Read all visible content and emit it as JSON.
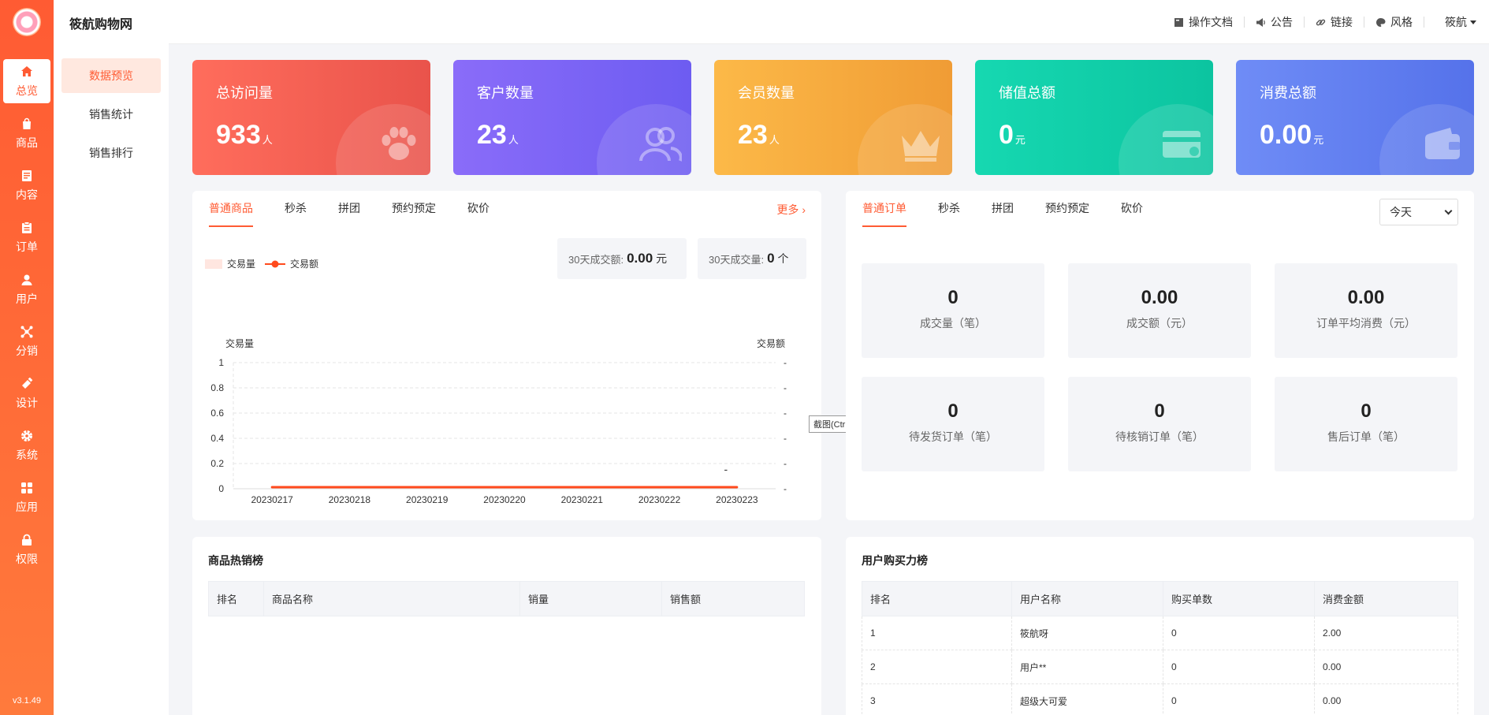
{
  "app": {
    "title": "筱航购物网",
    "version": "v3.1.49"
  },
  "sidebar": {
    "items": [
      {
        "label": "总览",
        "icon": "home-icon",
        "active": true
      },
      {
        "label": "商品",
        "icon": "shopping-bag-icon"
      },
      {
        "label": "内容",
        "icon": "document-icon"
      },
      {
        "label": "订单",
        "icon": "clipboard-icon"
      },
      {
        "label": "用户",
        "icon": "user-icon"
      },
      {
        "label": "分销",
        "icon": "share-network-icon"
      },
      {
        "label": "设计",
        "icon": "brush-icon"
      },
      {
        "label": "系统",
        "icon": "gear-icon"
      },
      {
        "label": "应用",
        "icon": "grid-apps-icon"
      },
      {
        "label": "权限",
        "icon": "lock-icon"
      }
    ]
  },
  "subnav": {
    "items": [
      {
        "label": "数据预览",
        "active": true
      },
      {
        "label": "销售统计"
      },
      {
        "label": "销售排行"
      }
    ]
  },
  "header": {
    "links": [
      {
        "label": "操作文档",
        "icon": "book-icon"
      },
      {
        "label": "公告",
        "icon": "megaphone-icon"
      },
      {
        "label": "链接",
        "icon": "link-icon"
      },
      {
        "label": "风格",
        "icon": "palette-icon"
      }
    ],
    "user": "筱航"
  },
  "stats": [
    {
      "label": "总访问量",
      "value": "933",
      "unit": "人",
      "icon": "paw-icon"
    },
    {
      "label": "客户数量",
      "value": "23",
      "unit": "人",
      "icon": "users-icon"
    },
    {
      "label": "会员数量",
      "value": "23",
      "unit": "人",
      "icon": "crown-icon"
    },
    {
      "label": "储值总额",
      "value": "0",
      "unit": "元",
      "icon": "card-icon"
    },
    {
      "label": "消费总额",
      "value": "0.00",
      "unit": "元",
      "icon": "wallet-icon"
    }
  ],
  "goods_panel": {
    "tabs": [
      "普通商品",
      "秒杀",
      "拼团",
      "预约预定",
      "砍价"
    ],
    "more": "更多",
    "legend": [
      "交易量",
      "交易额"
    ],
    "summary_amount_label": "30天成交额:",
    "summary_amount_value": "0.00",
    "summary_amount_unit": "元",
    "summary_count_label": "30天成交量:",
    "summary_count_value": "0",
    "summary_count_unit": "个",
    "tooltip": "截图(Ctrl + Alt + Z)"
  },
  "chart_data": {
    "type": "line",
    "x": [
      "20230217",
      "20230218",
      "20230219",
      "20230220",
      "20230221",
      "20230222",
      "20230223"
    ],
    "ylabel_left": "交易量",
    "ylabel_right": "交易额",
    "ylim": [
      0,
      1
    ],
    "yticks": [
      "0",
      "0.2",
      "0.4",
      "0.6",
      "0.8",
      "1"
    ],
    "series": [
      {
        "name": "交易量",
        "type": "bar",
        "values": [
          0,
          0,
          0,
          0,
          0,
          0,
          0
        ],
        "color": "#ffe6e0"
      },
      {
        "name": "交易额",
        "type": "line",
        "values": [
          0,
          0,
          0,
          0,
          0,
          0,
          0
        ],
        "color": "#ff4a1d"
      }
    ],
    "right_tick_label": "-",
    "annotation": "-",
    "legend": "top-left",
    "grid": true
  },
  "orders_panel": {
    "tabs": [
      "普通订单",
      "秒杀",
      "拼团",
      "预约预定",
      "砍价"
    ],
    "select_value": "今天",
    "stats": [
      {
        "value": "0",
        "label": "成交量（笔）"
      },
      {
        "value": "0.00",
        "label": "成交额（元）"
      },
      {
        "value": "0.00",
        "label": "订单平均消费（元）"
      },
      {
        "value": "0",
        "label": "待发货订单（笔）"
      },
      {
        "value": "0",
        "label": "待核销订单（笔）"
      },
      {
        "value": "0",
        "label": "售后订单（笔）"
      }
    ]
  },
  "hot_goods": {
    "title": "商品热销榜",
    "columns": [
      "排名",
      "商品名称",
      "销量",
      "销售额"
    ]
  },
  "user_rank": {
    "title": "用户购买力榜",
    "columns": [
      "排名",
      "用户名称",
      "购买单数",
      "消费金额"
    ],
    "rows": [
      [
        "1",
        "筱航呀",
        "0",
        "2.00"
      ],
      [
        "2",
        "用户**",
        "0",
        "0.00"
      ],
      [
        "3",
        "超级大可爱",
        "0",
        "0.00"
      ]
    ]
  },
  "colors": {
    "accent": "#ff5b33"
  }
}
